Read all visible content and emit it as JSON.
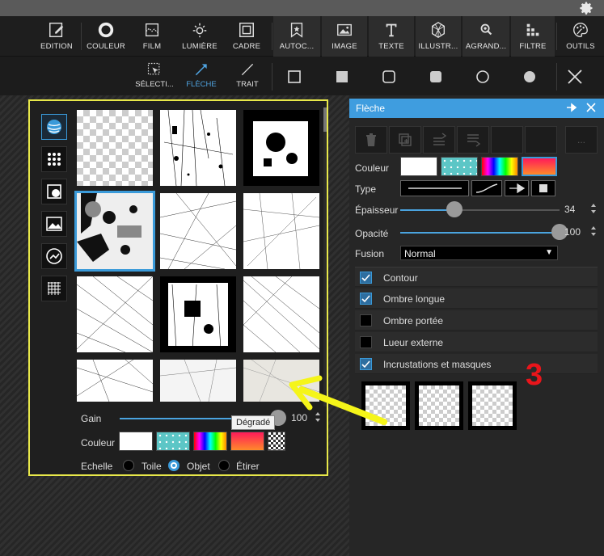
{
  "toolbar": {
    "items": [
      {
        "label": "EDITION",
        "icon": "edit-icon"
      },
      {
        "label": "COULEUR",
        "icon": "circle-ring-icon"
      },
      {
        "label": "FILM",
        "icon": "film-icon"
      },
      {
        "label": "LUMIÈRE",
        "icon": "sun-icon"
      },
      {
        "label": "CADRE",
        "icon": "frame-icon"
      },
      {
        "label": "AUTOC...",
        "icon": "sticker-icon"
      },
      {
        "label": "IMAGE",
        "icon": "image-icon"
      },
      {
        "label": "TEXTE",
        "icon": "text-icon"
      },
      {
        "label": "ILLUSTR...",
        "icon": "illustration-icon"
      },
      {
        "label": "AGRAND...",
        "icon": "zoom-icon"
      },
      {
        "label": "FILTRE",
        "icon": "filter-icon"
      },
      {
        "label": "OUTILS",
        "icon": "palette-icon"
      }
    ]
  },
  "subtoolbar": {
    "items": [
      {
        "label": "SÉLECTI...",
        "icon": "select-icon"
      },
      {
        "label": "FLÈCHE",
        "icon": "arrow-icon"
      },
      {
        "label": "TRAIT",
        "icon": "line-icon"
      }
    ],
    "shapes": [
      "square-outline-icon",
      "square-filled-icon",
      "rounded-square-outline-icon",
      "rounded-square-filled-icon",
      "circle-outline-icon",
      "circle-filled-icon"
    ]
  },
  "texture_panel": {
    "gain_label": "Gain",
    "gain_value": "100",
    "gain_fraction": 1.0,
    "couleur_label": "Couleur",
    "tooltip": "Dégradé",
    "echelle_label": "Echelle",
    "scale_options": [
      "Toile",
      "Objet",
      "Étirer"
    ],
    "scale_selected": "Objet"
  },
  "right_panel": {
    "title": "Flèche",
    "couleur_label": "Couleur",
    "type_label": "Type",
    "epaisseur_label": "Épaisseur",
    "epaisseur_value": "34",
    "epaisseur_fraction": 0.34,
    "opacite_label": "Opacité",
    "opacite_value": "100",
    "opacite_fraction": 1.0,
    "fusion_label": "Fusion",
    "fusion_value": "Normal",
    "more_label": "...",
    "options": [
      {
        "label": "Contour",
        "checked": true
      },
      {
        "label": "Ombre longue",
        "checked": true
      },
      {
        "label": "Ombre portée",
        "checked": false
      },
      {
        "label": "Lueur externe",
        "checked": false
      },
      {
        "label": "Incrustations et masques",
        "checked": true
      }
    ]
  },
  "annotation": {
    "step": "3",
    "color": "#e8151b",
    "arrow_color": "#f5f519"
  },
  "colors": {
    "accent": "#3f9ddf",
    "popup_border": "#e8e84a"
  }
}
